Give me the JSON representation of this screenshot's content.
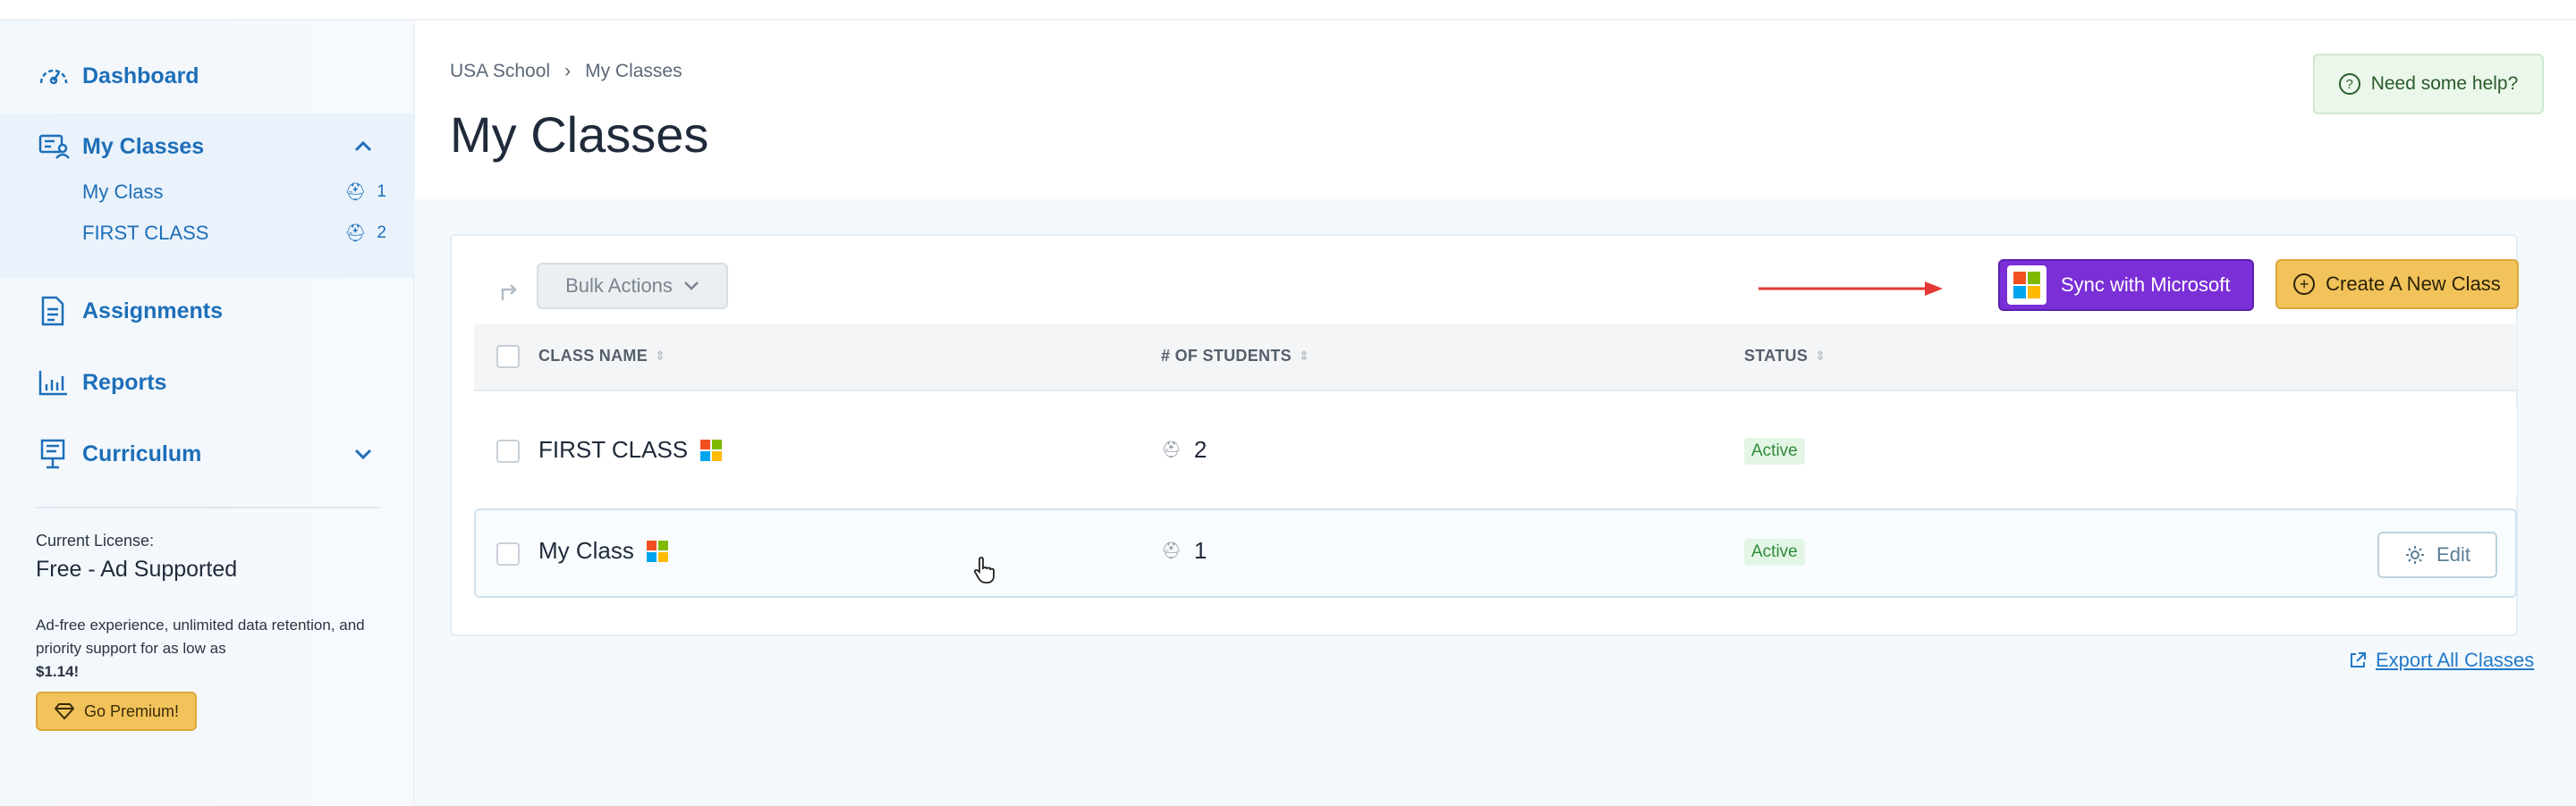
{
  "sidebar": {
    "nav": {
      "dashboard": "Dashboard",
      "my_classes": "My Classes",
      "assignments": "Assignments",
      "reports": "Reports",
      "curriculum": "Curriculum"
    },
    "sub_items": [
      {
        "label": "My Class",
        "count": "1"
      },
      {
        "label": "FIRST CLASS",
        "count": "2"
      }
    ],
    "license": {
      "label": "Current License:",
      "plan": "Free - Ad Supported",
      "description": "Ad-free experience, unlimited data retention, and priority support for as low as",
      "price": "$1.14!",
      "premium_button": "Go Premium!"
    }
  },
  "header": {
    "breadcrumb": {
      "school": "USA School",
      "separator": "›",
      "current": "My Classes"
    },
    "title": "My Classes",
    "help_button": "Need some help?"
  },
  "toolbar": {
    "bulk_actions": "Bulk Actions",
    "sync_microsoft": "Sync with Microsoft",
    "create_class": "Create A New Class"
  },
  "table": {
    "columns": {
      "class_name": "CLASS NAME",
      "students": "# OF STUDENTS",
      "status": "STATUS"
    },
    "rows": [
      {
        "name": "FIRST CLASS",
        "students": "2",
        "status": "Active"
      },
      {
        "name": "My Class",
        "students": "1",
        "status": "Active",
        "action": "Edit"
      }
    ]
  },
  "footer": {
    "export_link": "Export All Classes"
  },
  "colors": {
    "accent_blue": "#1d6fb8",
    "sync_purple": "#7b2fd6",
    "create_yellow": "#f2c35a",
    "active_green": "#2f8a3a",
    "annotation_arrow": "#e53935"
  }
}
